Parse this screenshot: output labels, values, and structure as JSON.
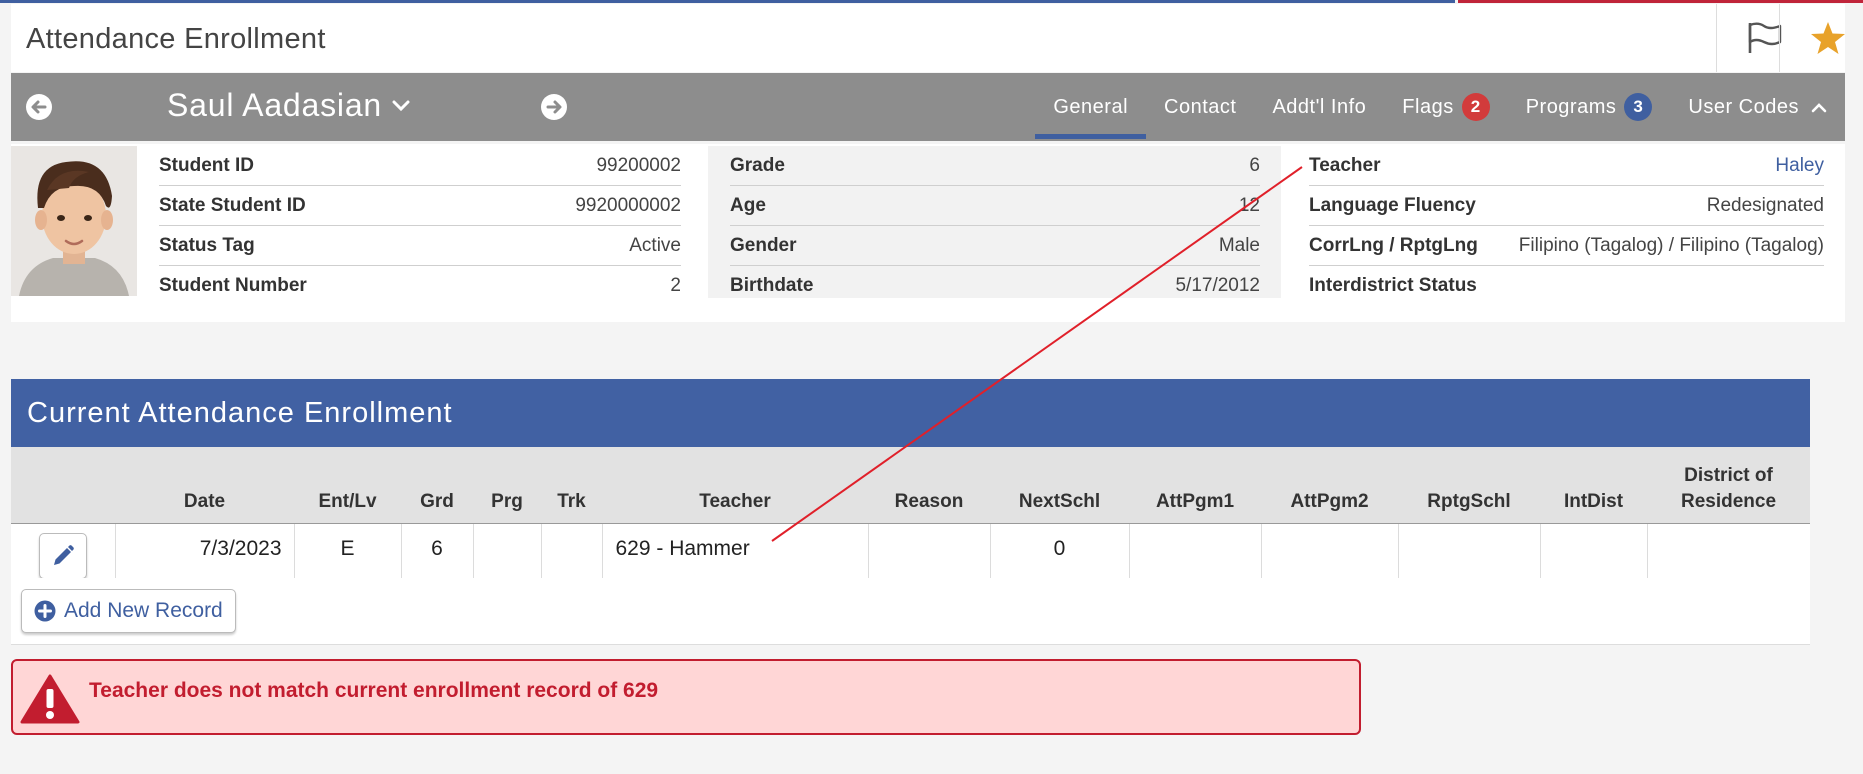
{
  "page": {
    "title": "Attendance Enrollment",
    "flag_icon": "flag-icon",
    "star_icon": "star-icon",
    "colors": {
      "primary": "#4161a3",
      "bar": "#8d8d8d",
      "alert": "#c21d2f",
      "star": "#e8a22a"
    }
  },
  "student": {
    "name": "Saul Aadasian",
    "prev_icon": "arrow-left-circle-icon",
    "next_icon": "arrow-right-circle-icon"
  },
  "tabs": [
    {
      "label": "General",
      "active": true
    },
    {
      "label": "Contact"
    },
    {
      "label": "Addt'l Info"
    },
    {
      "label": "Flags",
      "badge": "2",
      "badge_color": "red"
    },
    {
      "label": "Programs",
      "badge": "3",
      "badge_color": "blue"
    },
    {
      "label": "User Codes",
      "chevron": "up"
    }
  ],
  "info": {
    "col1": [
      {
        "label": "Student ID",
        "value": "99200002"
      },
      {
        "label": "State Student ID",
        "value": "9920000002"
      },
      {
        "label": "Status Tag",
        "value": "Active"
      },
      {
        "label": "Student Number",
        "value": "2"
      }
    ],
    "col2": [
      {
        "label": "Grade",
        "value": "6"
      },
      {
        "label": "Age",
        "value": "12"
      },
      {
        "label": "Gender",
        "value": "Male"
      },
      {
        "label": "Birthdate",
        "value": "5/17/2012"
      }
    ],
    "col3": [
      {
        "label": "Teacher",
        "value": "Haley"
      },
      {
        "label": "Language Fluency",
        "value": "Redesignated"
      },
      {
        "label": "CorrLng / RptgLng",
        "value": "Filipino (Tagalog) / Filipino (Tagalog)"
      },
      {
        "label": "Interdistrict Status",
        "value": ""
      }
    ]
  },
  "attendance": {
    "section_title": "Current Attendance Enrollment",
    "columns": [
      "",
      "Date",
      "Ent/Lv",
      "Grd",
      "Prg",
      "Trk",
      "Teacher",
      "Reason",
      "NextSchl",
      "AttPgm1",
      "AttPgm2",
      "RptgSchl",
      "IntDist",
      "District of Residence"
    ],
    "rows": [
      {
        "date": "7/3/2023",
        "ent_lv": "E",
        "grd": "6",
        "prg": "",
        "trk": "",
        "teacher": "629 - Hammer",
        "reason": "",
        "next_schl": "0",
        "att_pgm1": "",
        "att_pgm2": "",
        "rptg_schl": "",
        "int_dist": "",
        "district": ""
      }
    ],
    "add_label": "Add New Record"
  },
  "alert": {
    "icon": "warning-triangle-icon",
    "message": "Teacher does not match current enrollment record of 629"
  }
}
